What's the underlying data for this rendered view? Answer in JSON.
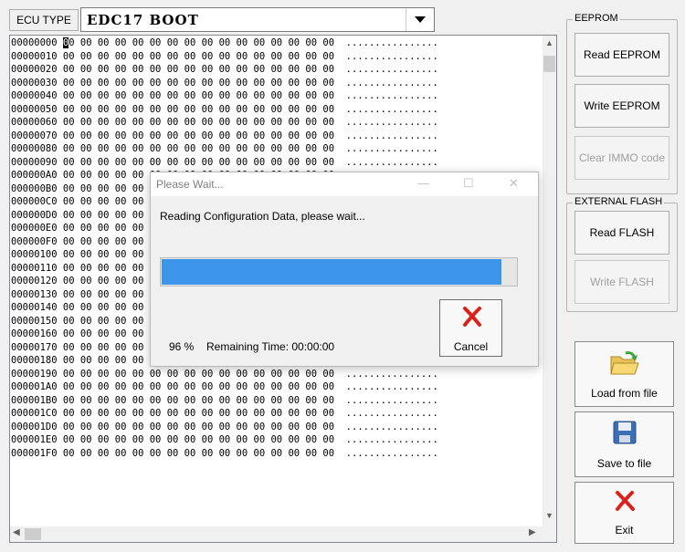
{
  "ecu": {
    "label": "ECU TYPE",
    "selected": "EDC17 BOOT"
  },
  "hex_rows": [
    {
      "addr": "00000000"
    },
    {
      "addr": "00000010"
    },
    {
      "addr": "00000020"
    },
    {
      "addr": "00000030"
    },
    {
      "addr": "00000040"
    },
    {
      "addr": "00000050"
    },
    {
      "addr": "00000060"
    },
    {
      "addr": "00000070"
    },
    {
      "addr": "00000080"
    },
    {
      "addr": "00000090"
    },
    {
      "addr": "000000A0"
    },
    {
      "addr": "000000B0"
    },
    {
      "addr": "000000C0"
    },
    {
      "addr": "000000D0"
    },
    {
      "addr": "000000E0"
    },
    {
      "addr": "000000F0"
    },
    {
      "addr": "00000100"
    },
    {
      "addr": "00000110"
    },
    {
      "addr": "00000120"
    },
    {
      "addr": "00000130"
    },
    {
      "addr": "00000140"
    },
    {
      "addr": "00000150"
    },
    {
      "addr": "00000160"
    },
    {
      "addr": "00000170"
    },
    {
      "addr": "00000180"
    },
    {
      "addr": "00000190"
    },
    {
      "addr": "000001A0"
    },
    {
      "addr": "000001B0"
    },
    {
      "addr": "000001C0"
    },
    {
      "addr": "000001D0"
    },
    {
      "addr": "000001E0"
    },
    {
      "addr": "000001F0"
    }
  ],
  "hex_bytes": "00 00 00 00 00 00 00 00 00 00 00 00 00 00 00 00",
  "hex_ascii": "................",
  "eeprom": {
    "legend": "EEPROM",
    "read": "Read EEPROM",
    "write": "Write EEPROM",
    "clear_immo": "Clear IMMO code"
  },
  "flash": {
    "legend": "EXTERNAL FLASH",
    "read": "Read FLASH",
    "write": "Write FLASH"
  },
  "actions": {
    "load": "Load from file",
    "save": "Save to file",
    "exit": "Exit"
  },
  "dialog": {
    "title": "Please Wait...",
    "message": "Reading Configuration Data, please wait...",
    "percent_text": "96 %",
    "progress": 0.96,
    "remaining": "Remaining Time: 00:00:00",
    "cancel": "Cancel"
  },
  "colors": {
    "progress_fill": "#3d95ea",
    "cancel_x": "#d9221c"
  }
}
